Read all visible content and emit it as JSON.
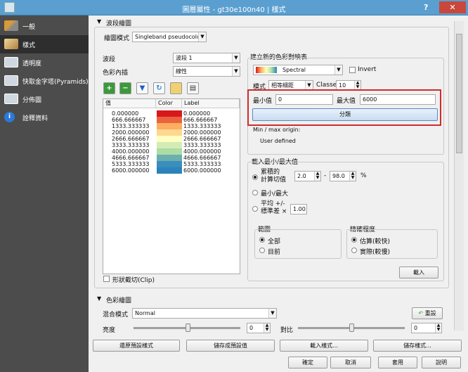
{
  "window": {
    "title": "圖層屬性 - gt30e100n40 | 樣式",
    "help": "?",
    "close": "✕"
  },
  "sidebar": {
    "items": [
      {
        "label": "一般",
        "icon": "wrench-icon",
        "color": "#d89a3a"
      },
      {
        "label": "樣式",
        "icon": "style-brush-icon",
        "color": "#e0c080"
      },
      {
        "label": "透明度",
        "icon": "transparency-icon",
        "color": "#8ab"
      },
      {
        "label": "快取金字塔(Pyramids)",
        "icon": "pyramid-icon",
        "color": "#9ab"
      },
      {
        "label": "分佈圖",
        "icon": "histogram-icon",
        "color": "#9ab"
      },
      {
        "label": "詮釋資料",
        "icon": "info-icon",
        "color": "#2a7ad8"
      }
    ]
  },
  "band_render": {
    "section_title": "波段繪圖",
    "render_type_label": "繪圖模式",
    "render_type_value": "Singleband pseudocolor",
    "band_label": "波段",
    "band_value": "波段 1",
    "interp_label": "色彩內插",
    "interp_value": "線性",
    "table_headers": [
      "值",
      "Color",
      "Label"
    ],
    "rows": [
      {
        "value": "0.000000",
        "label": "0.000000",
        "color": "#d7191c"
      },
      {
        "value": "666.666667",
        "label": "666.666667",
        "color": "#ea633e"
      },
      {
        "value": "1333.333333",
        "label": "1333.333333",
        "color": "#fdae61"
      },
      {
        "value": "2000.000000",
        "label": "2000.000000",
        "color": "#fed790"
      },
      {
        "value": "2666.666667",
        "label": "2666.666667",
        "color": "#ffffbf"
      },
      {
        "value": "3333.333333",
        "label": "3333.333333",
        "color": "#d3ecb7"
      },
      {
        "value": "4000.000000",
        "label": "4000.000000",
        "color": "#abdda4"
      },
      {
        "value": "4666.666667",
        "label": "4666.666667",
        "color": "#6bb0af"
      },
      {
        "value": "5333.333333",
        "label": "5333.333333",
        "color": "#3b8dbc"
      },
      {
        "value": "6000.000000",
        "label": "6000.000000",
        "color": "#2b83ba"
      }
    ],
    "clip_label": "形狀截切(Clip)"
  },
  "new_colormap": {
    "title": "建立新的色彩對映表",
    "ramp_value": "Spectral",
    "invert_label": "Invert",
    "mode_label": "模式",
    "mode_value": "相等細距",
    "classes_label": "Classes",
    "classes_value": "10",
    "min_label": "最小值",
    "min_value": "0",
    "max_label": "最大值",
    "max_value": "6000",
    "classify_button": "分類",
    "minmax_origin": "Min / max origin:",
    "user_defined": "User defined"
  },
  "load_minmax": {
    "title": "載入最小/最大值",
    "cumulative_label": "累積的\n計算切值",
    "cum_low": "2.0",
    "cum_high": "98.0",
    "pct": "%",
    "minmax_label": "最小/最大",
    "mean_label": "平均 +/-\n標準差 ×",
    "stddev_value": "1.00",
    "extent_title": "範圍",
    "extent_full": "全部",
    "extent_current": "目前",
    "accuracy_title": "精確程度",
    "accuracy_estimate": "估算(較快)",
    "accuracy_actual": "實際(較慢)",
    "load_button": "載入"
  },
  "color_render": {
    "section_title": "色彩繪圖",
    "blend_label": "混合模式",
    "blend_value": "Normal",
    "reset_button": "重設",
    "brightness_label": "亮度",
    "brightness_value": "0",
    "contrast_label": "對比",
    "contrast_value": "0"
  },
  "style_buttons": [
    "還原預設樣式",
    "儲存成預設值",
    "載入樣式...",
    "儲存樣式..."
  ],
  "dialog_buttons": [
    "確定",
    "取消",
    "套用",
    "說明"
  ]
}
